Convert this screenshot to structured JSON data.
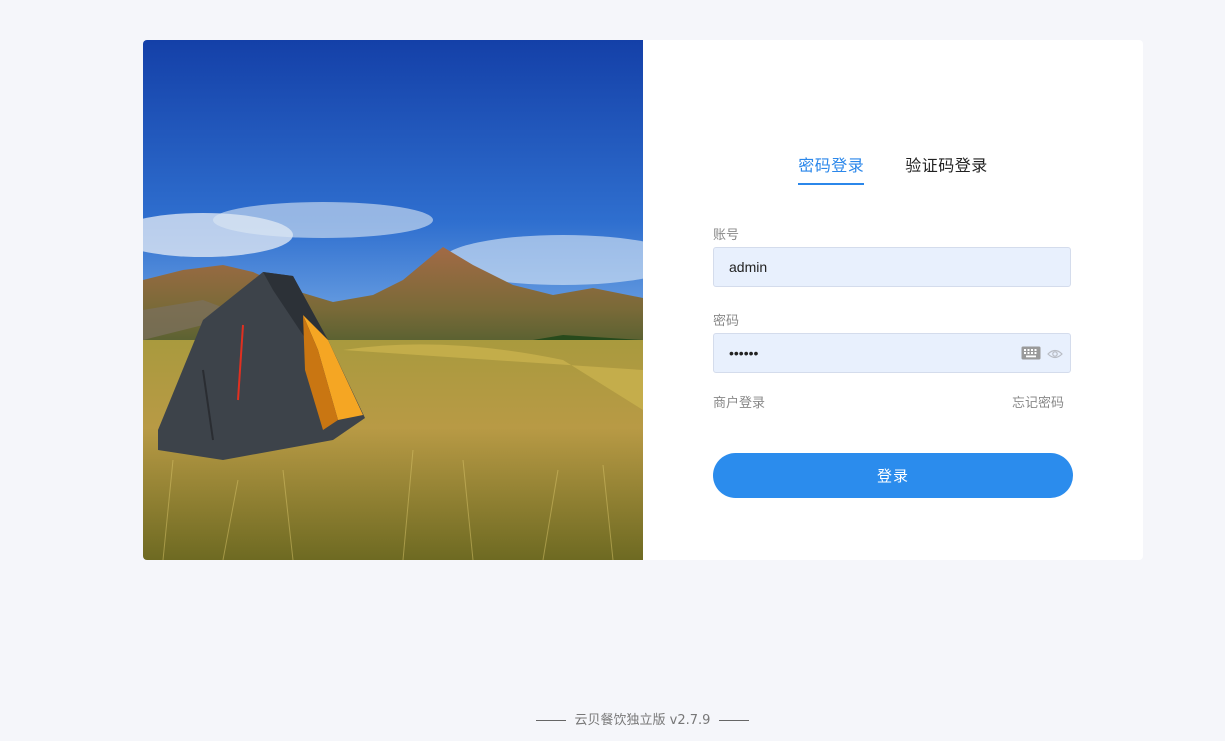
{
  "tabs": {
    "password_login": "密码登录",
    "code_login": "验证码登录"
  },
  "account": {
    "label": "账号",
    "value": "admin"
  },
  "password": {
    "label": "密码",
    "value": "••••••"
  },
  "links": {
    "merchant_login": "商户登录",
    "forgot_password": "忘记密码"
  },
  "login_button": "登录",
  "footer": {
    "text": "云贝餐饮独立版 v2.7.9"
  },
  "colors": {
    "accent": "#2b87ea",
    "input_bg": "#e8f0fd",
    "page_bg": "#f5f6fa"
  },
  "icons": {
    "keyboard": "keyboard-icon",
    "eye": "eye-icon"
  }
}
